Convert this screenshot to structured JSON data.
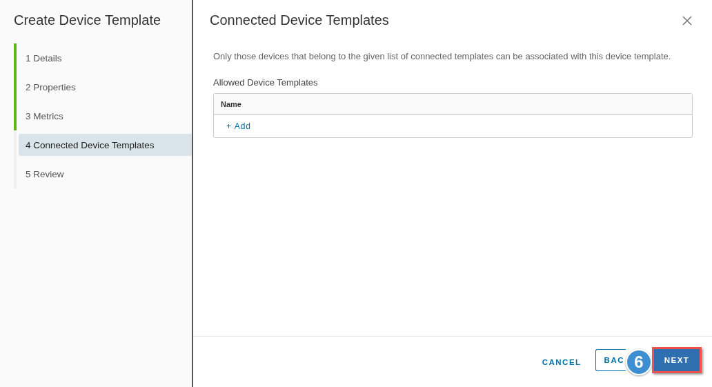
{
  "sidebar": {
    "title": "Create Device Template",
    "steps": [
      {
        "label": "1 Details",
        "completed": true,
        "selected": false
      },
      {
        "label": "2 Properties",
        "completed": true,
        "selected": false
      },
      {
        "label": "3 Metrics",
        "completed": true,
        "selected": false
      },
      {
        "label": "4 Connected Device Templates",
        "completed": false,
        "selected": true
      },
      {
        "label": "5 Review",
        "completed": false,
        "selected": false
      }
    ]
  },
  "main": {
    "title": "Connected Device Templates",
    "description": "Only those devices that belong to the given list of connected templates can be associated with this device template.",
    "section_label": "Allowed Device Templates",
    "table": {
      "columns": [
        "Name"
      ],
      "add_link": "+ Add"
    }
  },
  "footer": {
    "cancel": "CANCEL",
    "back": "BAC",
    "next": {
      "label": "NEXT",
      "highlighted": true
    },
    "badge": "6"
  }
}
